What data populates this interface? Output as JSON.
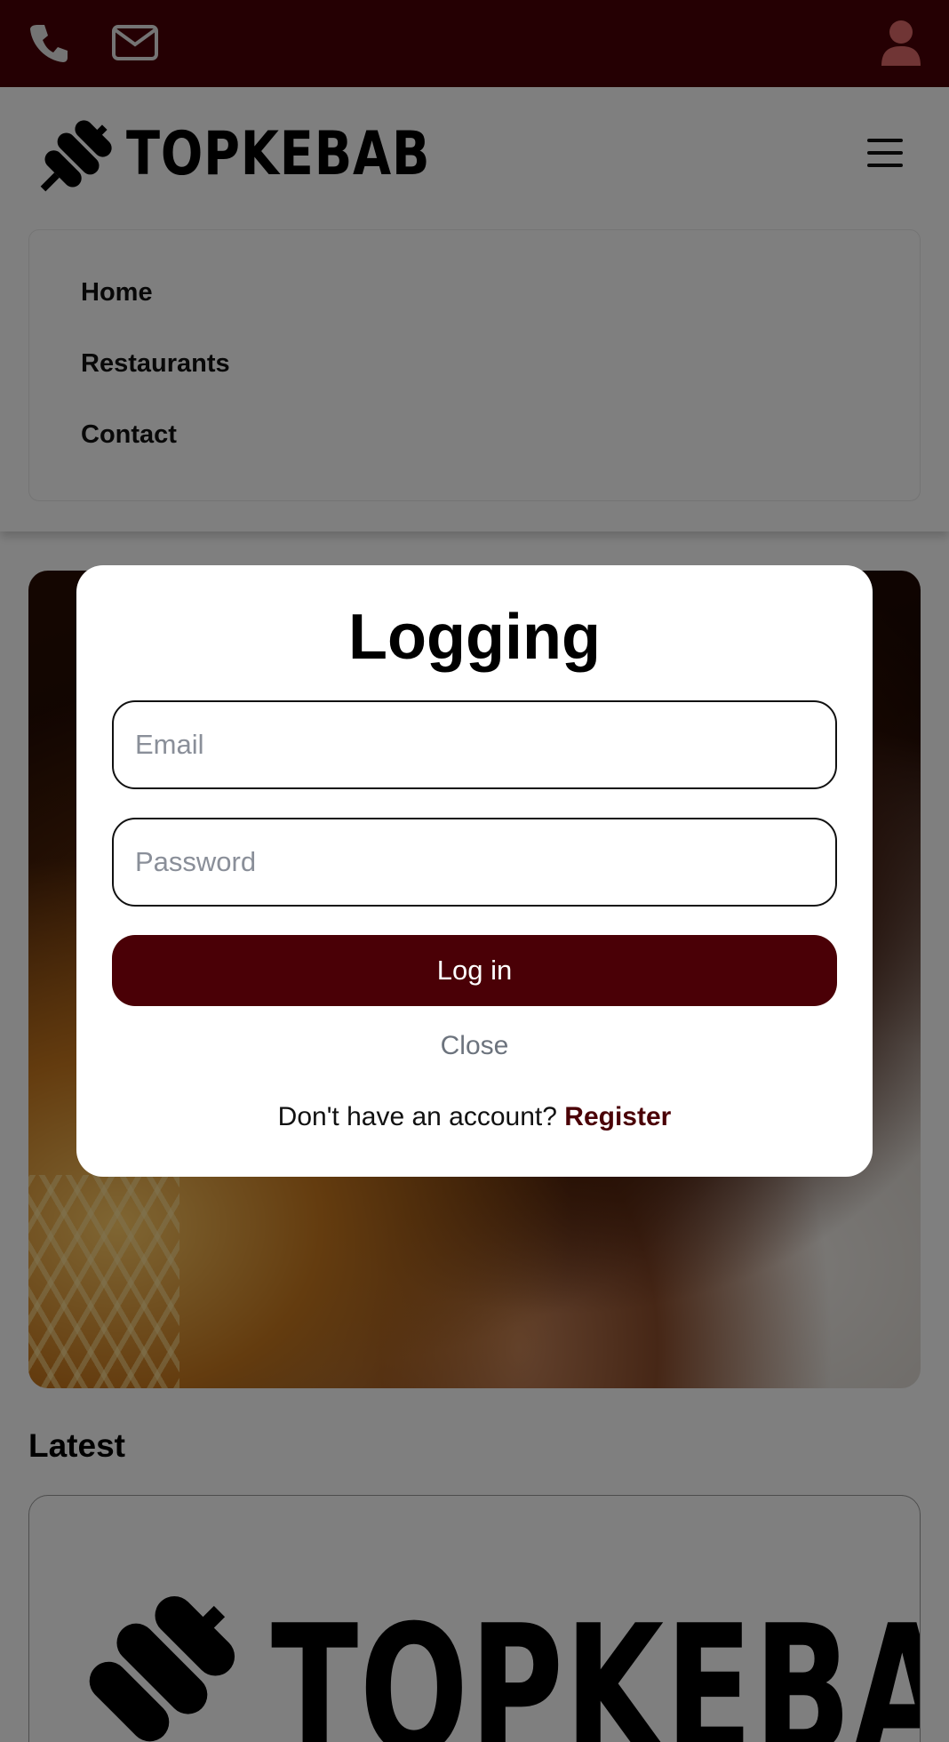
{
  "topbar": {
    "background": "#4a0006",
    "icons": [
      "phone-icon",
      "envelope-icon",
      "user-icon"
    ],
    "user_icon_color": "#e06b6b"
  },
  "header": {
    "brand": "TOPKEBAB",
    "nav": [
      {
        "label": "Home"
      },
      {
        "label": "Restaurants"
      },
      {
        "label": "Contact"
      }
    ]
  },
  "main": {
    "latest_heading": "Latest",
    "card_brand": "TOPKEBAB"
  },
  "modal": {
    "title": "Logging",
    "email_placeholder": "Email",
    "password_placeholder": "Password",
    "login_label": "Log in",
    "close_label": "Close",
    "register_prompt": "Don't have an account?",
    "register_label": "Register",
    "accent_color": "#4a0006"
  }
}
